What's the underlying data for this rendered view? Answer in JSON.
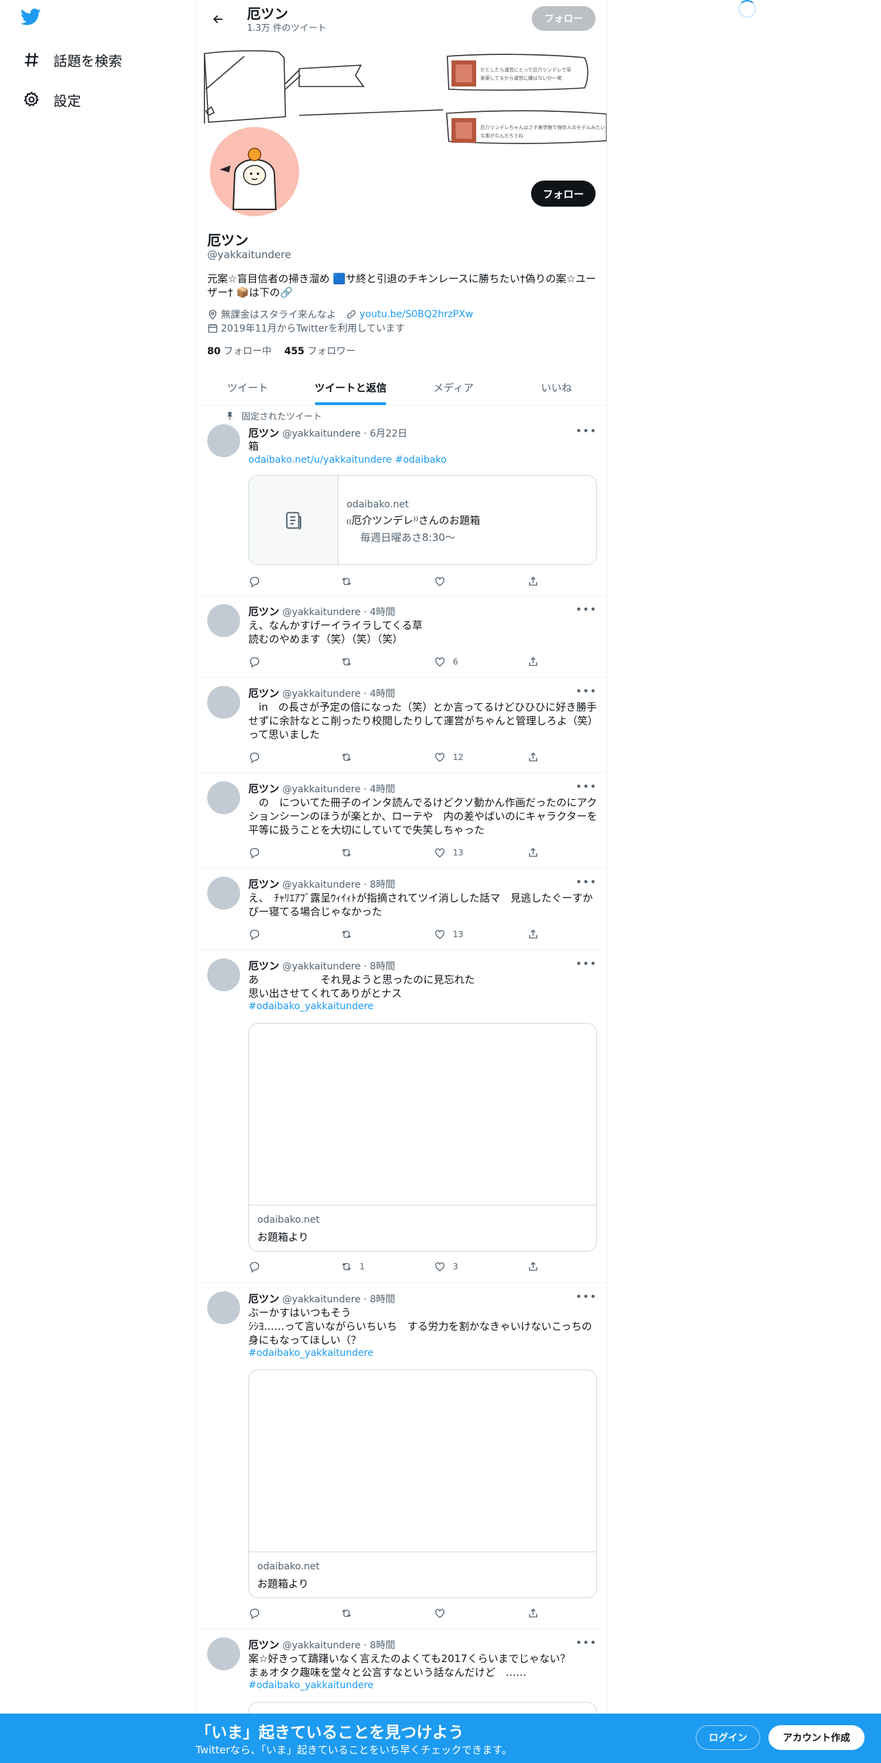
{
  "nav": {
    "explore": "話題を検索",
    "settings": "設定"
  },
  "header": {
    "name": "厄ツン",
    "tweet_count": "1.3万 件のツイート",
    "follow_label": "フォロー"
  },
  "profile": {
    "name": "厄ツン",
    "handle": "@yakkaitundere",
    "bio": "元案☆盲目信者の掃き溜め 🟦サ終と引退のチキンレースに勝ちたい†偽りの案☆ユーザー† 📦は下の🔗",
    "location": "無課金はスタライ来んなよ",
    "website": "youtu.be/S0BQ2hrzPXw",
    "joined": "2019年11月からTwitterを利用しています",
    "following_count": "80",
    "following_label": "フォロー中",
    "followers_count": "455",
    "followers_label": "フォロワー",
    "follow_label": "フォロー"
  },
  "banner": {
    "note1": "だとしたら運営にとって厄介ツンデレで草 楽案してるから運営に嫌はないか一笑",
    "note2": "厄介ツンデレちゃんはさす美学館で保存人のモデルみたいな素がなんだろうね"
  },
  "tabs": [
    {
      "label": "ツイート"
    },
    {
      "label": "ツイートと返信"
    },
    {
      "label": "メディア"
    },
    {
      "label": "いいね"
    }
  ],
  "pinned_label": "固定されたツイート",
  "tweets": [
    {
      "name": "厄ツン",
      "handle": "@yakkaitundere",
      "time": "6月22日",
      "text": "箱",
      "link": "odaibako.net/u/yakkaitundere #odaibako",
      "card": {
        "domain": "odaibako.net",
        "title": "₍₍厄介ツンデレ⁾⁾さんのお題箱",
        "desc": "毎週日曜あさ8:30〜"
      },
      "replies": "",
      "retweets": "",
      "likes": ""
    },
    {
      "name": "厄ツン",
      "handle": "@yakkaitundere",
      "time": "4時間",
      "text": "え、なんかすげーイライラしてくる草\n読むのやめます（笑）（笑）（笑）",
      "replies": "",
      "retweets": "",
      "likes": "6"
    },
    {
      "name": "厄ツン",
      "handle": "@yakkaitundere",
      "time": "4時間",
      "text": "　in　の長さが予定の倍になった（笑）とか言ってるけどひひひに好き勝手せずに余計なとこ削ったり校閲したりして運営がちゃんと管理しろよ（笑）って思いました",
      "replies": "",
      "retweets": "",
      "likes": "12"
    },
    {
      "name": "厄ツン",
      "handle": "@yakkaitundere",
      "time": "4時間",
      "text": "　の　についてた冊子のインタ読んでるけどクソ動かん作画だったのにアクションシーンのほうが楽とか、ローテや　内の差やばいのにキャラクターを平等に扱うことを大切にしていてで失笑しちゃった",
      "replies": "",
      "retweets": "",
      "likes": "13"
    },
    {
      "name": "厄ツン",
      "handle": "@yakkaitundere",
      "time": "8時間",
      "text": "え、　ﾁｬﾘｴｱﾌﾞ露呈ｳｨｲｨﾄが指摘されてツイ消しした話マ　見逃したぐーすかぴー寝てる場合じゃなかった",
      "replies": "",
      "retweets": "",
      "likes": "13"
    },
    {
      "name": "厄ツン",
      "handle": "@yakkaitundere",
      "time": "8時間",
      "text": "あ　　　　　　それ見ようと思ったのに見忘れた\n思い出させてくれてありがとナス",
      "link": "#odaibako_yakkaitundere",
      "card": {
        "domain": "odaibako.net",
        "title": "お題箱より"
      },
      "replies": "",
      "retweets": "1",
      "likes": "3"
    },
    {
      "name": "厄ツン",
      "handle": "@yakkaitundere",
      "time": "8時間",
      "text": "ぶーかすはいつもそう\nｼｼﾖ……って言いながらいちいち　する労力を割かなきゃいけないこっちの身にもなってほしい（？",
      "link": "#odaibako_yakkaitundere",
      "card": {
        "domain": "odaibako.net",
        "title": "お題箱より"
      },
      "replies": "",
      "retweets": "",
      "likes": ""
    },
    {
      "name": "厄ツン",
      "handle": "@yakkaitundere",
      "time": "8時間",
      "text": "案☆好きって躊躇いなく言えたのよくても2017くらいまでじゃない？\nまぁオタク趣味を堂々と公言すなという話なんだけど　……",
      "link": "#odaibako_yakkaitundere"
    }
  ],
  "bottom_bar": {
    "title": "「いま」起きていることを見つけよう",
    "subtitle": "Twitterなら、「いま」起きていることをいち早くチェックできます。",
    "login": "ログイン",
    "signup": "アカウント作成"
  },
  "colors": {
    "accent": "#1d9bf0",
    "text": "#0f1419",
    "muted": "#536471"
  }
}
